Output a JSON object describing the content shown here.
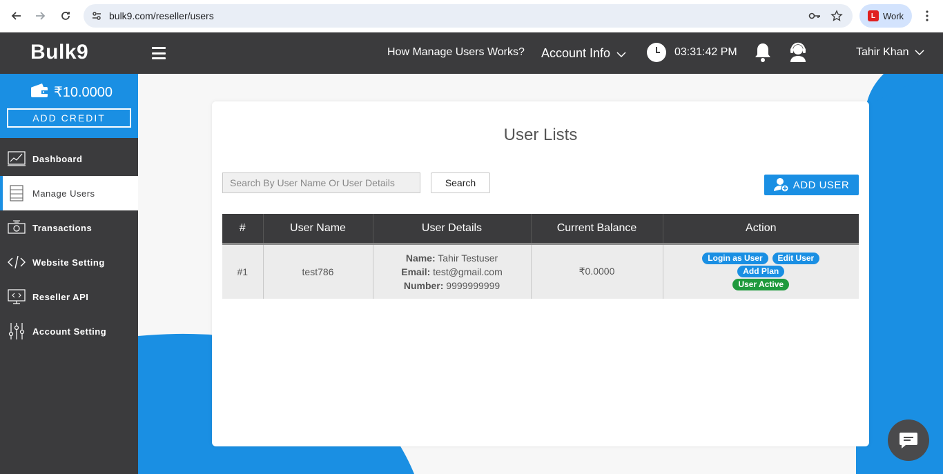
{
  "browser": {
    "url": "bulk9.com/reseller/users",
    "profile_label": "Work"
  },
  "header": {
    "logo": "Bulk9",
    "help_link": "How Manage Users Works?",
    "account_menu": "Account Info",
    "time": "03:31:42 PM",
    "user_menu": "Tahir Khan"
  },
  "sidebar": {
    "balance": "₹10.0000",
    "add_credit": "ADD CREDIT",
    "items": [
      {
        "label": "Dashboard",
        "icon": "chart-icon"
      },
      {
        "label": "Manage Users",
        "icon": "users-list-icon",
        "active": true
      },
      {
        "label": "Transactions",
        "icon": "money-icon"
      },
      {
        "label": "Website Setting",
        "icon": "code-icon"
      },
      {
        "label": "Reseller API",
        "icon": "api-icon"
      },
      {
        "label": "Account Setting",
        "icon": "sliders-icon"
      }
    ]
  },
  "main": {
    "title": "User Lists",
    "search_placeholder": "Search By User Name Or User Details",
    "search_button": "Search",
    "add_user_button": "ADD USER",
    "table": {
      "columns": [
        "#",
        "User Name",
        "User Details",
        "Current Balance",
        "Action"
      ],
      "rows": [
        {
          "index": "#1",
          "username": "test786",
          "details": {
            "name_label": "Name:",
            "name": "Tahir Testuser",
            "email_label": "Email:",
            "email": "test@gmail.com",
            "number_label": "Number:",
            "number": "9999999999"
          },
          "balance": "₹0.0000",
          "actions": {
            "login": "Login as User",
            "edit": "Edit User",
            "add_plan": "Add Plan",
            "status": "User Active"
          }
        }
      ]
    }
  },
  "colors": {
    "accent": "#1a8fe3",
    "dark": "#3b3b3d",
    "success": "#1f9a3d"
  }
}
